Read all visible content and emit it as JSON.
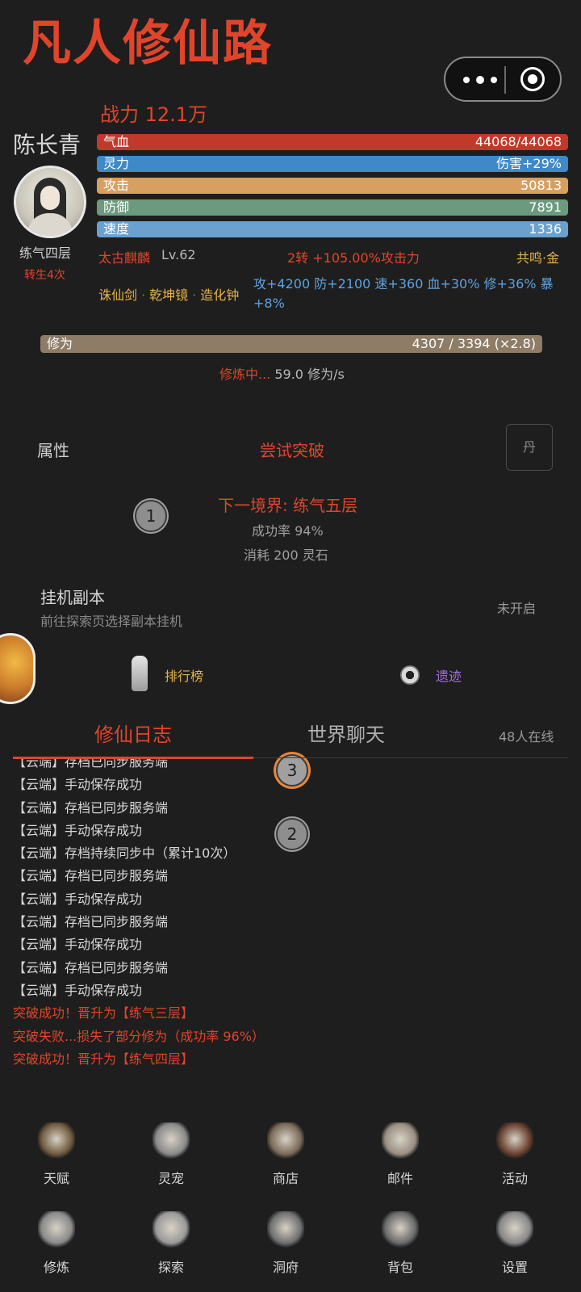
{
  "header": {
    "title": "凡人修仙路"
  },
  "capsule": {
    "more_label": "more",
    "close_label": "close"
  },
  "character": {
    "power": "战力 12.1万",
    "name": "陈长青",
    "realm": "练气四层",
    "rebirth": "转生4次"
  },
  "stats": [
    {
      "label": "气血",
      "value": "44068/44068"
    },
    {
      "label": "灵力",
      "value": "伤害+29%"
    },
    {
      "label": "攻击",
      "value": "50813"
    },
    {
      "label": "防御",
      "value": "7891"
    },
    {
      "label": "速度",
      "value": "1336"
    }
  ],
  "pet": {
    "name": "太古麒麟",
    "level": "Lv.62",
    "bonus": "2转 +105.00%攻击力",
    "resonance": "共鸣·金"
  },
  "equipment": {
    "items": [
      "诛仙剑",
      "乾坤镜",
      "造化钟"
    ],
    "separator": "·",
    "bonus": "攻+4200 防+2100 速+360 血+30% 修+36% 暴+8%"
  },
  "cultivation": {
    "label": "修为",
    "value": "4307 / 3394 (×2.8)",
    "status": "修炼中...",
    "rate": "59.0 修为/s"
  },
  "breakthrough": {
    "attr_label": "属性",
    "button": "尝试突破",
    "dan_button": "丹",
    "next_realm": "下一境界: 练气五层",
    "success_rate": "成功率 94%",
    "cost": "消耗 200 灵石"
  },
  "afk": {
    "title": "挂机副本",
    "desc": "前往探索页选择副本挂机",
    "status": "未开启"
  },
  "shortcuts": {
    "rank": "排行榜",
    "ruins": "遗迹"
  },
  "markers": {
    "m1": "1",
    "m2": "2",
    "m3": "3"
  },
  "tabs": {
    "log": "修仙日志",
    "chat": "世界聊天",
    "online": "48人在线"
  },
  "log": [
    {
      "text": "【云端】存档已同步服务端",
      "type": "normal"
    },
    {
      "text": "【云端】手动保存成功",
      "type": "normal"
    },
    {
      "text": "【云端】存档已同步服务端",
      "type": "normal"
    },
    {
      "text": "【云端】手动保存成功",
      "type": "normal"
    },
    {
      "text": "【云端】存档持续同步中（累计10次）",
      "type": "normal"
    },
    {
      "text": "【云端】存档已同步服务端",
      "type": "normal"
    },
    {
      "text": "【云端】手动保存成功",
      "type": "normal"
    },
    {
      "text": "【云端】存档已同步服务端",
      "type": "normal"
    },
    {
      "text": "【云端】手动保存成功",
      "type": "normal"
    },
    {
      "text": "【云端】存档已同步服务端",
      "type": "normal"
    },
    {
      "text": "【云端】手动保存成功",
      "type": "normal"
    },
    {
      "text": "突破成功！晋升为【练气三层】",
      "type": "red"
    },
    {
      "text": "突破失败...损失了部分修为（成功率 96%）",
      "type": "red"
    },
    {
      "text": "突破成功！晋升为【练气四层】",
      "type": "red"
    }
  ],
  "nav": [
    {
      "label": "天赋",
      "icon": "scroll-icon"
    },
    {
      "label": "灵宠",
      "icon": "spirit-pet-icon"
    },
    {
      "label": "商店",
      "icon": "shop-pavilion-icon"
    },
    {
      "label": "邮件",
      "icon": "mail-icon"
    },
    {
      "label": "活动",
      "icon": "lantern-icon"
    },
    {
      "label": "修炼",
      "icon": "meditation-icon"
    },
    {
      "label": "探索",
      "icon": "mountain-icon"
    },
    {
      "label": "洞府",
      "icon": "cave-icon"
    },
    {
      "label": "背包",
      "icon": "bag-icon"
    },
    {
      "label": "设置",
      "icon": "gear-icon"
    }
  ]
}
